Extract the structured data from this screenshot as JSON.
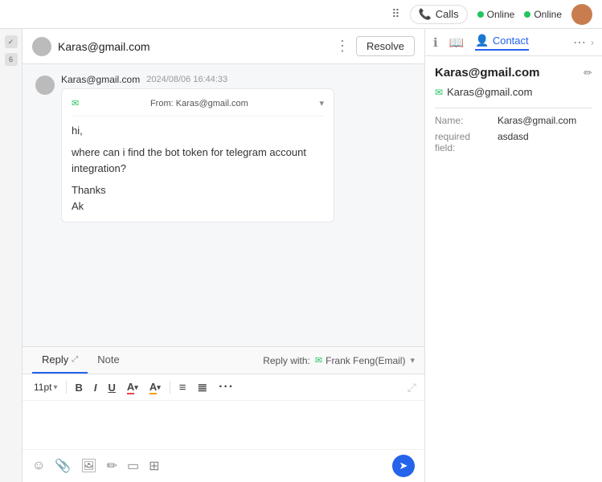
{
  "topbar": {
    "apps_icon": "⠿",
    "calls_label": "Calls",
    "online1": "Online",
    "online2": "Online"
  },
  "chat": {
    "user_email": "Karas@gmail.com",
    "resolve_label": "Resolve",
    "message": {
      "sender": "Karas@gmail.com",
      "time": "2024/08/06 16:44:33",
      "from_label": "From: Karas@gmail.com",
      "line1": "hi,",
      "line2": "where can i find the bot token for telegram account integration?",
      "line3": "Thanks",
      "line4": "Ak"
    }
  },
  "reply": {
    "tab_reply": "Reply",
    "tab_note": "Note",
    "reply_with_label": "Reply with:",
    "reply_with_value": "Frank Feng(Email)",
    "font_size": "11pt",
    "toolbar": {
      "bold": "B",
      "italic": "I",
      "underline": "U",
      "more_label": "···"
    }
  },
  "right_panel": {
    "contact_tab": "Contact",
    "contact_name": "Karas@gmail.com",
    "contact_email": "Karas@gmail.com",
    "field_name_label": "Name:",
    "field_name_value": "Karas@gmail.com",
    "field_required_label": "required field:",
    "field_required_value": "asdasd"
  }
}
